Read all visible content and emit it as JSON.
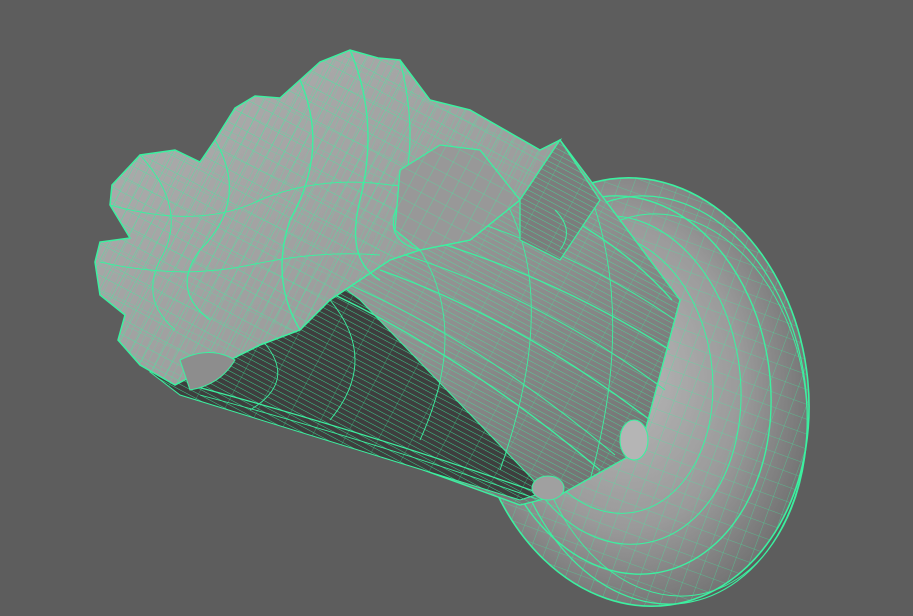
{
  "viewport": {
    "background": "#5d5d5d",
    "wire_color": "#3cf0a0",
    "surface_light": "#a3a3a3",
    "surface_mid": "#8a8a8a",
    "surface_dark": "#4a4a4a"
  }
}
